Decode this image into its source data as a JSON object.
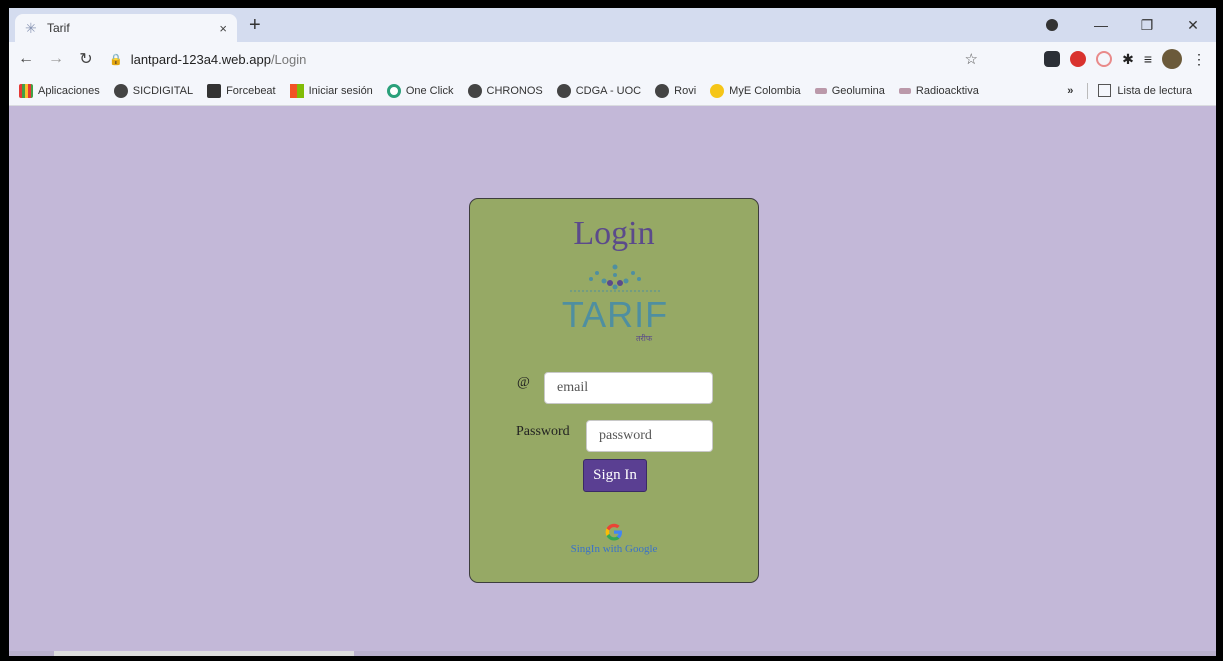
{
  "browser": {
    "tab_title": "Tarif",
    "tab_close": "×",
    "new_tab": "+",
    "url_host": "lantpard-123a4.web.app",
    "url_path": "/Login",
    "bookmarks": [
      {
        "label": "Aplicaciones",
        "icon": "apps-icon"
      },
      {
        "label": "SICDIGITAL",
        "icon": "globe-icon"
      },
      {
        "label": "Forcebeat",
        "icon": "forcebeat-icon"
      },
      {
        "label": "Iniciar sesión",
        "icon": "microsoft-icon"
      },
      {
        "label": "One Click",
        "icon": "oneclick-icon"
      },
      {
        "label": "CHRONOS",
        "icon": "globe-icon"
      },
      {
        "label": "CDGA - UOC",
        "icon": "globe-icon"
      },
      {
        "label": "Rovi",
        "icon": "globe-icon"
      },
      {
        "label": "MyE Colombia",
        "icon": "bulb-icon"
      },
      {
        "label": "Geolumina",
        "icon": "geolumina-icon"
      },
      {
        "label": "Radioacktiva",
        "icon": "radio-icon"
      }
    ],
    "bookmarks_more": "»",
    "reading_list": "Lista de lectura"
  },
  "login": {
    "title": "Login",
    "logo_text": "TARIF",
    "logo_subtext": "तरीफ",
    "email_label": "@",
    "email_placeholder": "email",
    "password_label": "Password",
    "password_placeholder": "password",
    "signin_label": "Sign In",
    "google_label": "SingIn with Google"
  },
  "colors": {
    "page_bg": "#c3b8d8",
    "card_bg": "#96a965",
    "title": "#5b4a8b",
    "button_bg": "#5a3f92",
    "logo": "#4f8fa0"
  }
}
